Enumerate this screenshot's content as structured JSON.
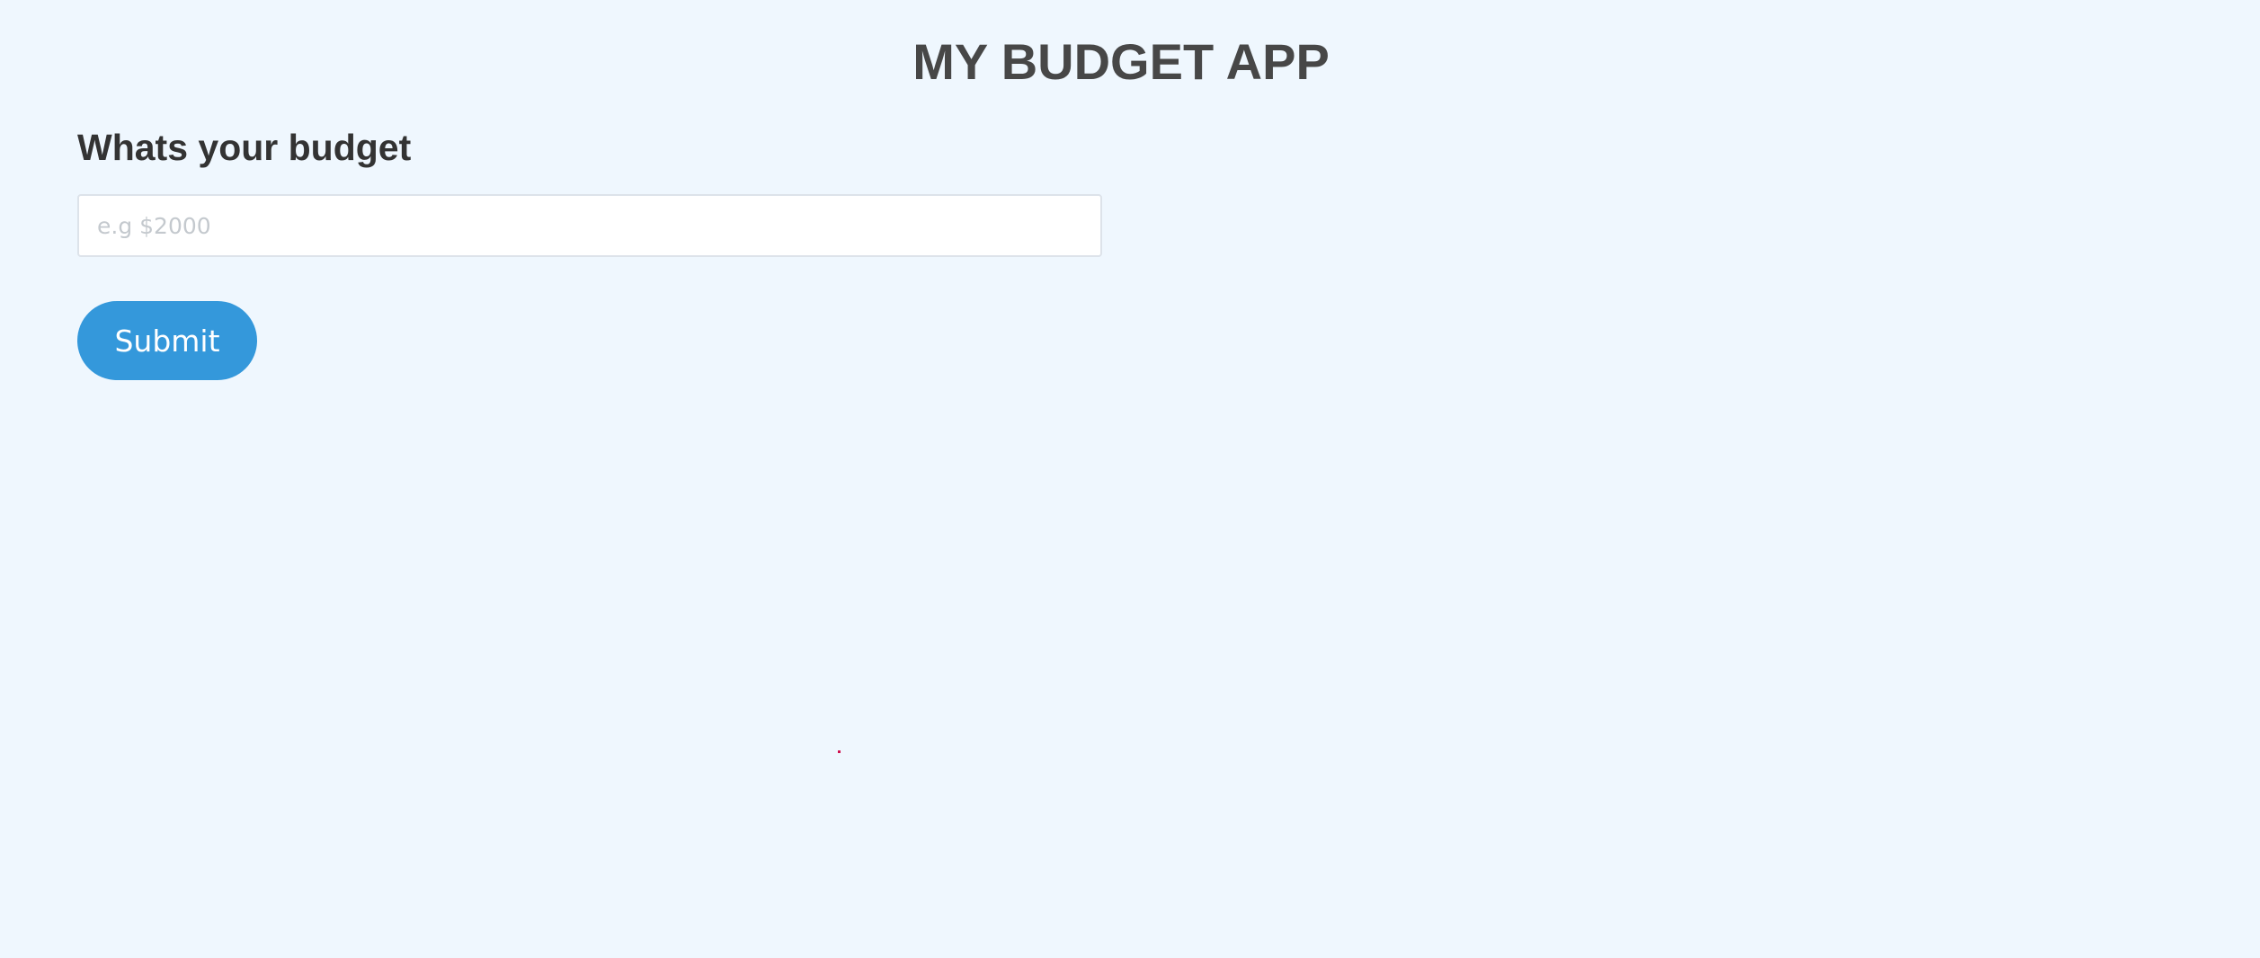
{
  "app": {
    "title": "MY BUDGET APP"
  },
  "budget_form": {
    "heading": "Whats your budget",
    "input_value": "",
    "input_placeholder": "e.g $2000",
    "submit_label": "Submit"
  },
  "colors": {
    "background": "#eff7fe",
    "title_text": "#474747",
    "heading_text": "#333333",
    "button_bg": "#3498db",
    "button_text": "#ffffff",
    "input_border": "#dde3ea",
    "placeholder": "#c4c9ce"
  }
}
